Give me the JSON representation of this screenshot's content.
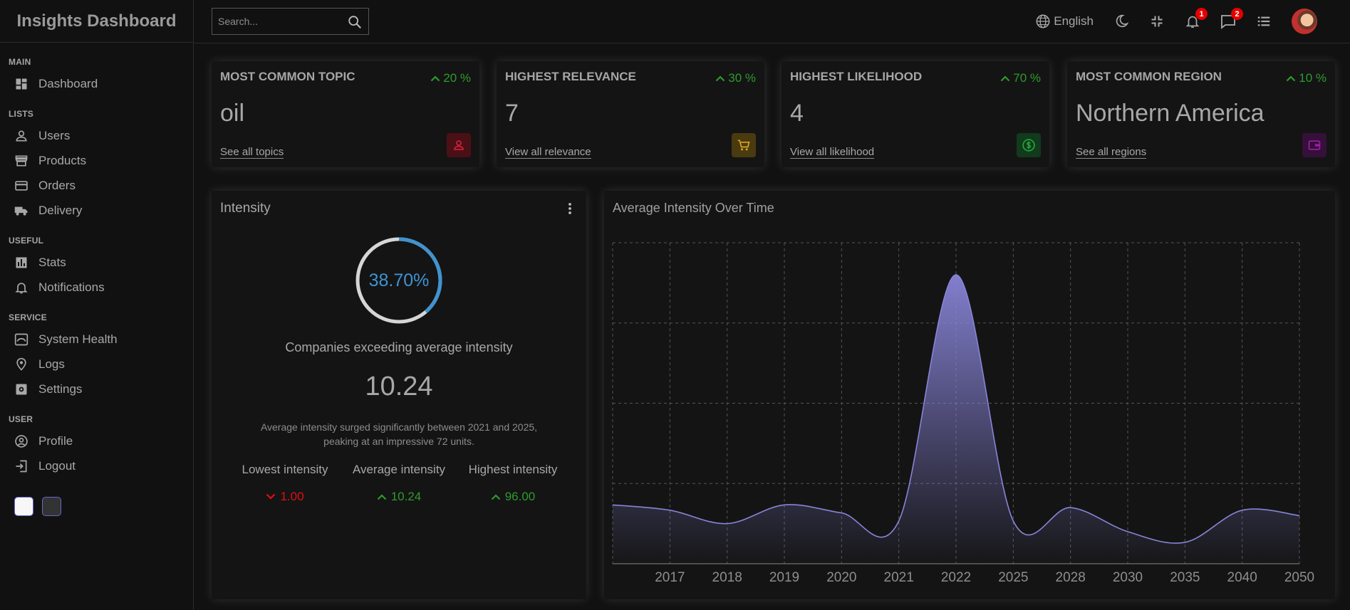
{
  "app": {
    "title": "Insights Dashboard"
  },
  "sidebar": {
    "sections": [
      {
        "title": "MAIN",
        "items": [
          {
            "label": "Dashboard",
            "icon": "dashboard-icon"
          }
        ]
      },
      {
        "title": "LISTS",
        "items": [
          {
            "label": "Users",
            "icon": "user-icon"
          },
          {
            "label": "Products",
            "icon": "store-icon"
          },
          {
            "label": "Orders",
            "icon": "credit-card-icon"
          },
          {
            "label": "Delivery",
            "icon": "truck-icon"
          }
        ]
      },
      {
        "title": "USEFUL",
        "items": [
          {
            "label": "Stats",
            "icon": "bar-chart-icon"
          },
          {
            "label": "Notifications",
            "icon": "bell-icon"
          }
        ]
      },
      {
        "title": "SERVICE",
        "items": [
          {
            "label": "System Health",
            "icon": "system-health-icon"
          },
          {
            "label": "Logs",
            "icon": "logs-icon"
          },
          {
            "label": "Settings",
            "icon": "settings-icon"
          }
        ]
      },
      {
        "title": "USER",
        "items": [
          {
            "label": "Profile",
            "icon": "profile-icon"
          },
          {
            "label": "Logout",
            "icon": "logout-icon"
          }
        ]
      }
    ]
  },
  "topbar": {
    "search_placeholder": "Search...",
    "language": "English",
    "notifications_count": "1",
    "messages_count": "2"
  },
  "widgets": [
    {
      "title": "MOST COMMON TOPIC",
      "percent": "20 %",
      "value": "oil",
      "link": "See all topics",
      "icon": "person-icon",
      "icon_color": "#e0213c",
      "icon_bg": "#4a1016"
    },
    {
      "title": "HIGHEST RELEVANCE",
      "percent": "30 %",
      "value": "7",
      "link": "View all relevance",
      "icon": "cart-icon",
      "icon_color": "#d9a520",
      "icon_bg": "#4a3a10"
    },
    {
      "title": "HIGHEST LIKELIHOOD",
      "percent": "70 %",
      "value": "4",
      "link": "View all likelihood",
      "icon": "dollar-icon",
      "icon_color": "#22a83c",
      "icon_bg": "#123a1c"
    },
    {
      "title": "MOST COMMON REGION",
      "percent": "10 %",
      "value": "Northern America",
      "link": "See all regions",
      "icon": "wallet-icon",
      "icon_color": "#a01ca8",
      "icon_bg": "#35103a"
    }
  ],
  "intensity": {
    "title": "Intensity",
    "percent_text": "38.70%",
    "percent_value": 0.387,
    "subtitle": "Companies exceeding average intensity",
    "average": "10.24",
    "description_line1": "Average intensity surged significantly between 2021 and 2025,",
    "description_line2": "peaking at an impressive 72 units.",
    "stats": [
      {
        "label": "Lowest intensity",
        "value": "1.00",
        "trend": "down"
      },
      {
        "label": "Average intensity",
        "value": "10.24",
        "trend": "up"
      },
      {
        "label": "Highest intensity",
        "value": "96.00",
        "trend": "up"
      }
    ]
  },
  "chart_data": {
    "type": "area",
    "title": "Average Intensity Over Time",
    "categories": [
      "",
      "2017",
      "2018",
      "2019",
      "2020",
      "2021",
      "2022",
      "2025",
      "2028",
      "2030",
      "2035",
      "2040",
      "2050"
    ],
    "values": [
      11,
      10,
      7.5,
      11,
      9.5,
      8,
      54,
      8,
      10.5,
      6,
      4,
      10,
      9
    ],
    "ylim": [
      0,
      60
    ],
    "grid": true,
    "line_color": "#8884d8"
  }
}
